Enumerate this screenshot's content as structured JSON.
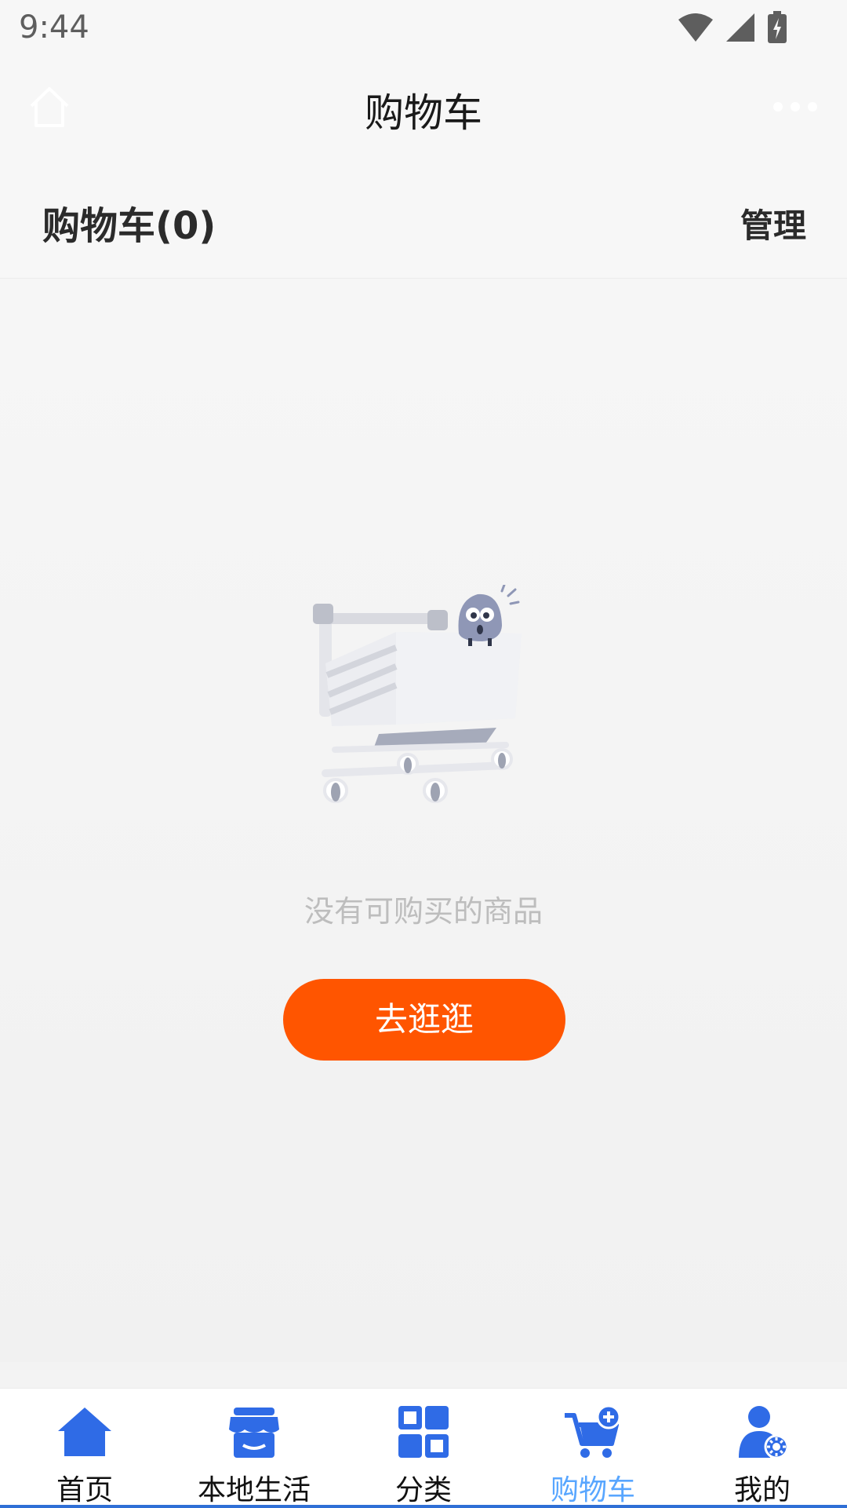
{
  "status": {
    "time": "9:44"
  },
  "nav": {
    "title": "购物车"
  },
  "cart": {
    "title": "购物车(0)",
    "manage_label": "管理"
  },
  "empty": {
    "message": "没有可购买的商品",
    "button_label": "去逛逛"
  },
  "tabs": [
    {
      "label": "首页",
      "icon": "home-icon",
      "active": false
    },
    {
      "label": "本地生活",
      "icon": "store-icon",
      "active": false
    },
    {
      "label": "分类",
      "icon": "grid-icon",
      "active": false
    },
    {
      "label": "购物车",
      "icon": "cart-icon",
      "active": true
    },
    {
      "label": "我的",
      "icon": "user-settings-icon",
      "active": false
    }
  ],
  "colors": {
    "accent_orange": "#ff5500",
    "tab_icon_blue": "#2f6be6",
    "tab_active_text": "#58a6ff"
  }
}
